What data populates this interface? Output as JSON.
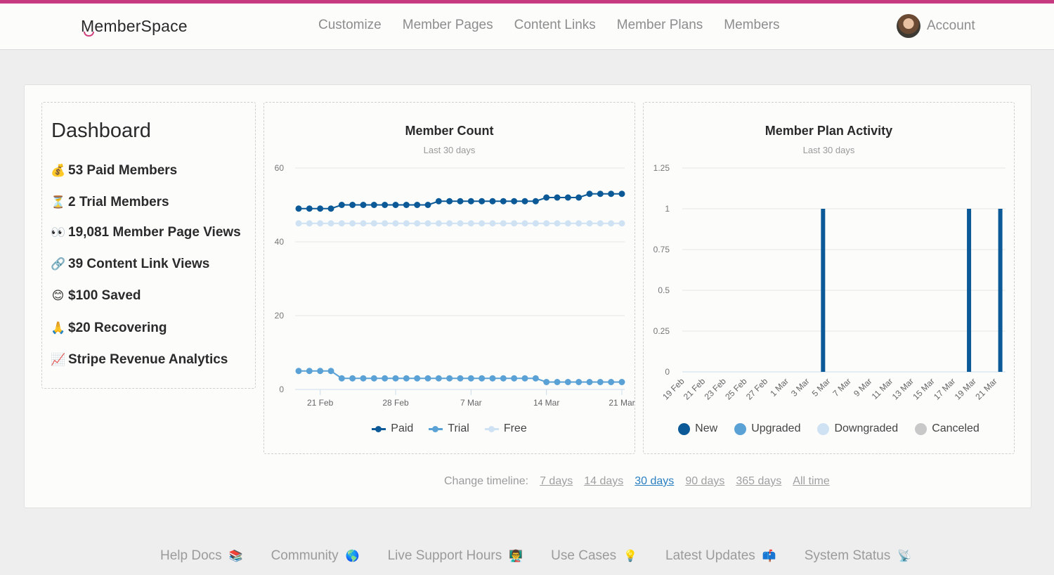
{
  "header": {
    "logo": "MemberSpace",
    "nav": [
      "Customize",
      "Member Pages",
      "Content Links",
      "Member Plans",
      "Members"
    ],
    "account_label": "Account"
  },
  "colors": {
    "brand": "#c83a80",
    "paid": "#0b5a97",
    "trial": "#5aa1d5",
    "free": "#cfe2f3",
    "new": "#0b5a97",
    "upgraded": "#5aa1d5",
    "downgraded": "#cfe2f3",
    "canceled": "#c8c8c8",
    "active_link": "#2a7fc1"
  },
  "dashboard": {
    "title": "Dashboard",
    "stats": [
      {
        "icon": "money-bag-icon",
        "emoji": "💰",
        "label": "53 Paid Members"
      },
      {
        "icon": "hourglass-icon",
        "emoji": "⏳",
        "label": "2 Trial Members"
      },
      {
        "icon": "eyes-icon",
        "emoji": "👀",
        "label": "19,081 Member Page Views"
      },
      {
        "icon": "link-icon",
        "emoji": "🔗",
        "label": "39 Content Link Views"
      },
      {
        "icon": "smile-icon",
        "emoji": "😊",
        "label": "$100 Saved"
      },
      {
        "icon": "pray-icon",
        "emoji": "🙏",
        "label": "$20 Recovering"
      },
      {
        "icon": "chart-up-icon",
        "emoji": "📈",
        "label": "Stripe Revenue Analytics"
      }
    ]
  },
  "timeline": {
    "label": "Change timeline:",
    "options": [
      "7 days",
      "14 days",
      "30 days",
      "90 days",
      "365 days",
      "All time"
    ],
    "active": "30 days"
  },
  "footer": [
    {
      "label": "Help Docs",
      "emoji": "📚",
      "icon": "books-icon"
    },
    {
      "label": "Community",
      "emoji": "🌎",
      "icon": "globe-icon"
    },
    {
      "label": "Live Support Hours",
      "emoji": "👨‍🏫",
      "icon": "teacher-icon"
    },
    {
      "label": "Use Cases",
      "emoji": "💡",
      "icon": "lightbulb-icon"
    },
    {
      "label": "Latest Updates",
      "emoji": "📫",
      "icon": "mailbox-icon"
    },
    {
      "label": "System Status",
      "emoji": "📡",
      "icon": "satellite-icon"
    }
  ],
  "chart_data": [
    {
      "type": "line",
      "title": "Member Count",
      "subtitle": "Last 30 days",
      "x": [
        "19 Feb",
        "20 Feb",
        "21 Feb",
        "22 Feb",
        "23 Feb",
        "24 Feb",
        "25 Feb",
        "26 Feb",
        "27 Feb",
        "28 Feb",
        "1 Mar",
        "2 Mar",
        "3 Mar",
        "4 Mar",
        "5 Mar",
        "6 Mar",
        "7 Mar",
        "8 Mar",
        "9 Mar",
        "10 Mar",
        "11 Mar",
        "12 Mar",
        "13 Mar",
        "14 Mar",
        "15 Mar",
        "16 Mar",
        "17 Mar",
        "18 Mar",
        "19 Mar",
        "20 Mar",
        "21 Mar"
      ],
      "xticks": [
        "21 Feb",
        "28 Feb",
        "7 Mar",
        "14 Mar",
        "21 Mar"
      ],
      "yticks": [
        0,
        20,
        40,
        60
      ],
      "ylim": [
        0,
        60
      ],
      "grid": true,
      "legend": "bottom",
      "series": [
        {
          "name": "Paid",
          "values": [
            49,
            49,
            49,
            49,
            50,
            50,
            50,
            50,
            50,
            50,
            50,
            50,
            50,
            51,
            51,
            51,
            51,
            51,
            51,
            51,
            51,
            51,
            51,
            52,
            52,
            52,
            52,
            53,
            53,
            53,
            53
          ]
        },
        {
          "name": "Trial",
          "values": [
            5,
            5,
            5,
            5,
            3,
            3,
            3,
            3,
            3,
            3,
            3,
            3,
            3,
            3,
            3,
            3,
            3,
            3,
            3,
            3,
            3,
            3,
            3,
            2,
            2,
            2,
            2,
            2,
            2,
            2,
            2
          ]
        },
        {
          "name": "Free",
          "values": [
            45,
            45,
            45,
            45,
            45,
            45,
            45,
            45,
            45,
            45,
            45,
            45,
            45,
            45,
            45,
            45,
            45,
            45,
            45,
            45,
            45,
            45,
            45,
            45,
            45,
            45,
            45,
            45,
            45,
            45,
            45
          ]
        }
      ]
    },
    {
      "type": "bar",
      "title": "Member Plan Activity",
      "subtitle": "Last 30 days",
      "categories": [
        "19 Feb",
        "20 Feb",
        "21 Feb",
        "22 Feb",
        "23 Feb",
        "24 Feb",
        "25 Feb",
        "26 Feb",
        "27 Feb",
        "28 Feb",
        "1 Mar",
        "2 Mar",
        "3 Mar",
        "4 Mar",
        "5 Mar",
        "6 Mar",
        "7 Mar",
        "8 Mar",
        "9 Mar",
        "10 Mar",
        "11 Mar",
        "12 Mar",
        "13 Mar",
        "14 Mar",
        "15 Mar",
        "16 Mar",
        "17 Mar",
        "18 Mar",
        "19 Mar",
        "20 Mar",
        "21 Mar"
      ],
      "xticks": [
        "19 Feb",
        "21 Feb",
        "23 Feb",
        "25 Feb",
        "27 Feb",
        "1 Mar",
        "3 Mar",
        "5 Mar",
        "7 Mar",
        "9 Mar",
        "11 Mar",
        "13 Mar",
        "15 Mar",
        "17 Mar",
        "19 Mar",
        "21 Mar"
      ],
      "yticks": [
        0,
        0.25,
        0.5,
        0.75,
        1,
        1.25
      ],
      "ylim": [
        0,
        1.25
      ],
      "grid": true,
      "legend": "bottom",
      "series": [
        {
          "name": "New",
          "values": [
            0,
            0,
            0,
            0,
            0,
            0,
            0,
            0,
            0,
            0,
            0,
            0,
            0,
            1,
            0,
            0,
            0,
            0,
            0,
            0,
            0,
            0,
            0,
            0,
            0,
            0,
            0,
            1,
            0,
            0,
            1
          ]
        },
        {
          "name": "Upgraded",
          "values": [
            0,
            0,
            0,
            0,
            0,
            0,
            0,
            0,
            0,
            0,
            0,
            0,
            0,
            0,
            0,
            0,
            0,
            0,
            0,
            0,
            0,
            0,
            0,
            0,
            0,
            0,
            0,
            0,
            0,
            0,
            0
          ]
        },
        {
          "name": "Downgraded",
          "values": [
            0,
            0,
            0,
            0,
            0,
            0,
            0,
            0,
            0,
            0,
            0,
            0,
            0,
            0,
            0,
            0,
            0,
            0,
            0,
            0,
            0,
            0,
            0,
            0,
            0,
            0,
            0,
            0,
            0,
            0,
            0
          ]
        },
        {
          "name": "Canceled",
          "values": [
            0,
            0,
            0,
            0,
            0,
            0,
            0,
            0,
            0,
            0,
            0,
            0,
            0,
            0,
            0,
            0,
            0,
            0,
            0,
            0,
            0,
            0,
            0,
            0,
            0,
            0,
            0,
            0,
            0,
            0,
            0
          ]
        }
      ]
    }
  ]
}
